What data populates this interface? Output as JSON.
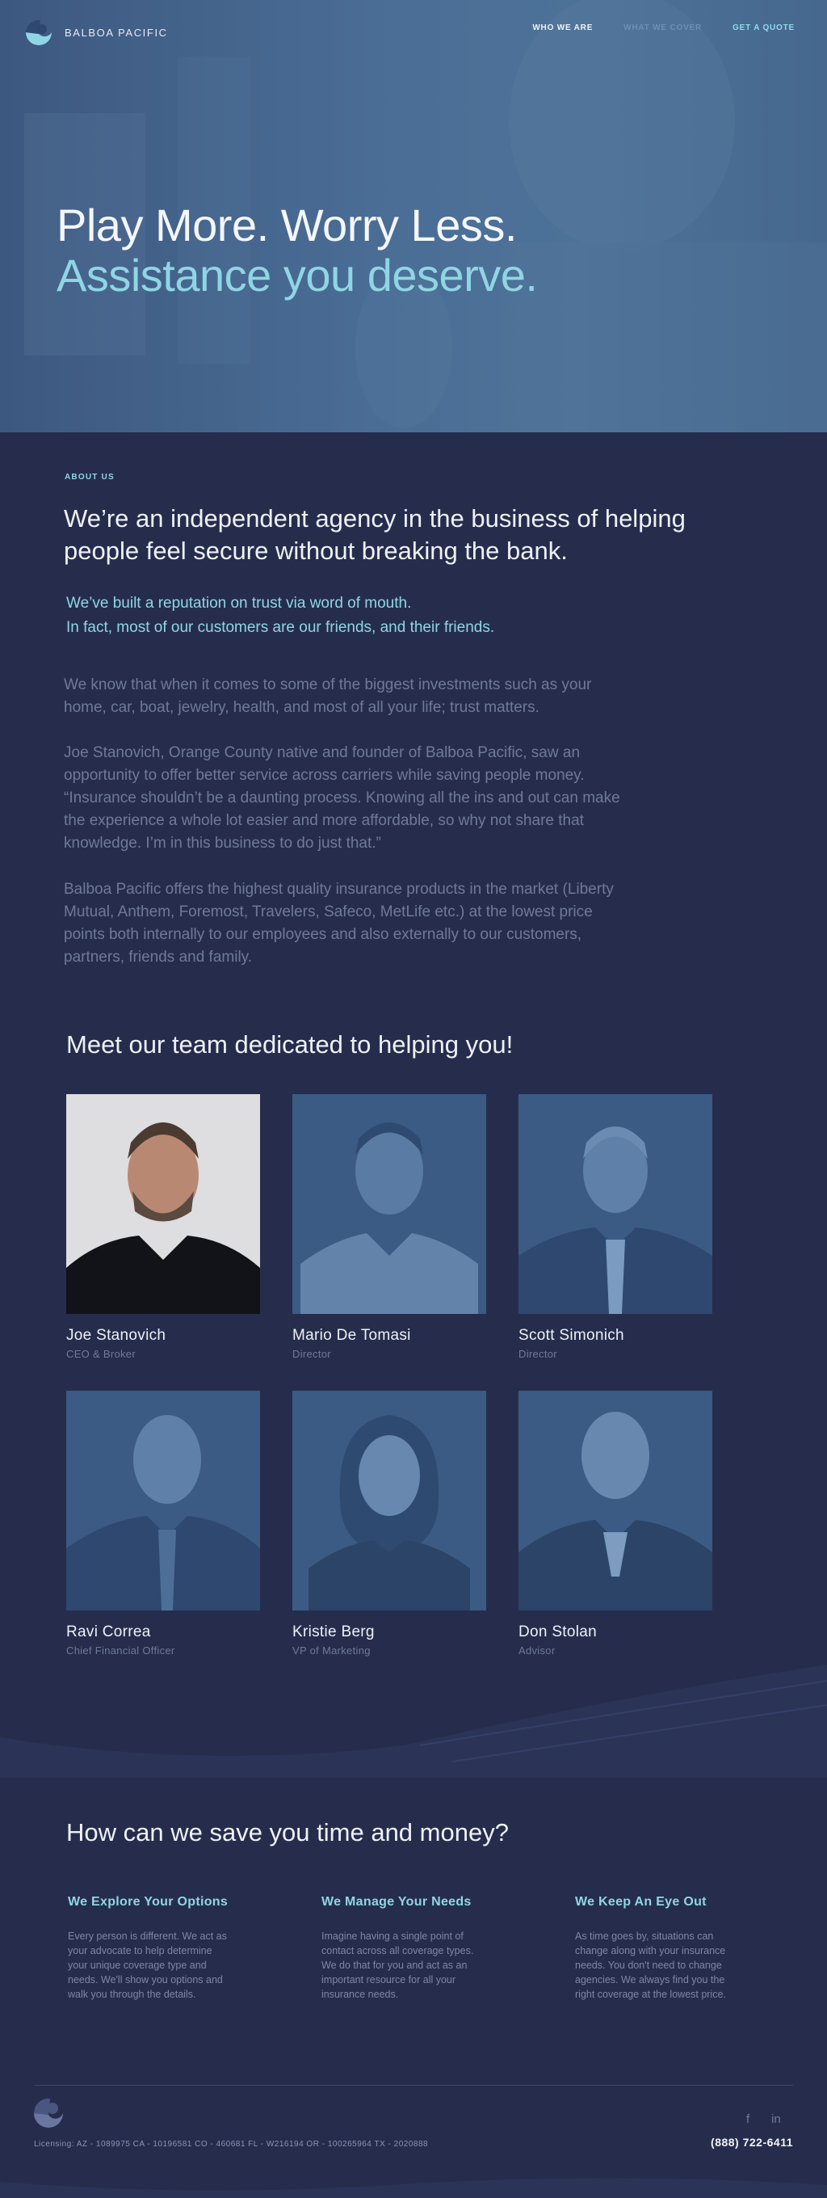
{
  "brand": {
    "name": "BALBOA PACIFIC"
  },
  "nav": {
    "links": [
      "WHO WE ARE",
      "WHAT WE COVER",
      "GET A QUOTE"
    ]
  },
  "hero": {
    "title": "Play More. Worry Less.",
    "subtitle": "Assistance you deserve."
  },
  "about": {
    "label": "ABOUT US",
    "heading_line1": "We’re an independent agency in the business of helping",
    "heading_line2": "people feel secure without breaking the bank.",
    "highlight_line1": "We’ve built a reputation on trust via word of mouth.",
    "highlight_line2": "In fact, most of our customers are our friends, and their friends.",
    "p1": [
      "We know that when it comes to some of the biggest investments such as your",
      "home, car, boat, jewelry, health, and most of all your life; trust matters."
    ],
    "p2": [
      "Joe Stanovich, Orange County native and founder of Balboa Pacific, saw an",
      "opportunity to offer better service across carriers while saving people money.",
      "“Insurance shouldn’t be a daunting process. Knowing all the ins and out can make",
      "the experience a whole lot easier and more affordable, so why not share that",
      "knowledge. I’m in this business to do just that.”"
    ],
    "p3": [
      "Balboa Pacific offers the highest quality insurance products in the market (Liberty",
      "Mutual, Anthem, Foremost, Travelers, Safeco, MetLife etc.) at the lowest price",
      "points both internally to our employees and also externally to our customers,",
      "partners, friends and family."
    ]
  },
  "team": {
    "title": "Meet our team dedicated to helping you!",
    "members": [
      {
        "name": "Joe Stanovich",
        "role": "CEO & Broker"
      },
      {
        "name": "Mario De Tomasi",
        "role": "Director"
      },
      {
        "name": "Scott Simonich",
        "role": "Director"
      },
      {
        "name": "Ravi Correa",
        "role": "Chief Financial Officer"
      },
      {
        "name": "Kristie Berg",
        "role": "VP of Marketing"
      },
      {
        "name": "Don Stolan",
        "role": "Advisor"
      }
    ]
  },
  "save": {
    "title": "How can we save you time and money?",
    "columns": [
      {
        "title": "We Explore Your Options",
        "lines": [
          "Every person is different. We act as",
          "your advocate to help determine",
          "your unique coverage type and",
          "needs. We'll show you options and",
          "walk you through the details."
        ]
      },
      {
        "title": "We Manage Your Needs",
        "lines": [
          "Imagine having a single point of",
          "contact across all coverage types.",
          "We do that for you and act as an",
          "important resource for all your",
          "insurance needs."
        ]
      },
      {
        "title": "We Keep An Eye Out",
        "lines": [
          "As time goes by, situations can",
          "change along with your insurance",
          "needs. You don't need to change",
          "agencies. We always find you the",
          "right coverage at the lowest price."
        ]
      }
    ]
  },
  "footer": {
    "licensing": "Licensing: AZ - 1089975 CA - 10196581 CO - 460681 FL - W216194 OR - 100265964 TX - 2020888",
    "phone": "(888) 722-6411",
    "social_facebook": "f",
    "social_linkedin": "in"
  },
  "colors": {
    "background": "#262d4c",
    "accent": "#8fd6e4",
    "hero": "#4a6d95"
  }
}
